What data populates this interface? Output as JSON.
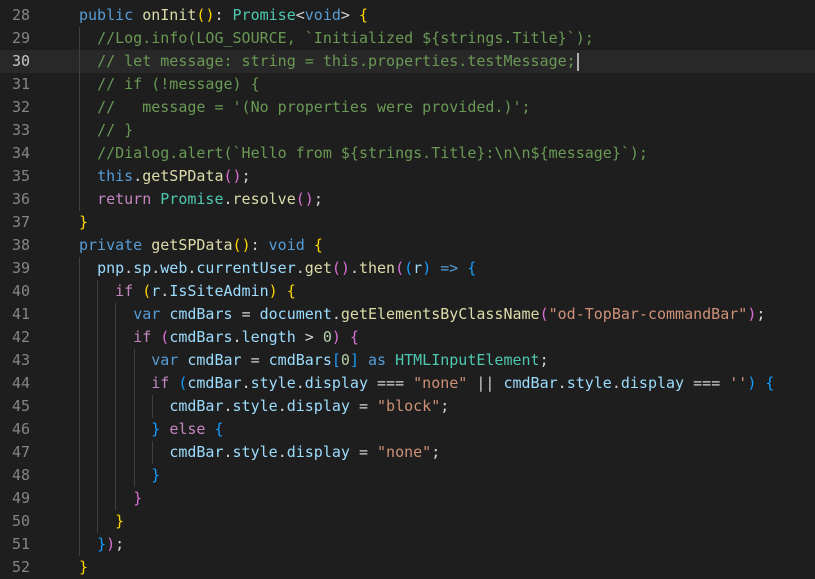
{
  "editor": {
    "language": "typescript",
    "active_line": 30,
    "colors": {
      "background": "#1e1e1e",
      "keyword": "#569cd6",
      "control": "#c586c0",
      "function": "#dcdcaa",
      "variable": "#9cdcfe",
      "type": "#4ec9b0",
      "string": "#ce9178",
      "comment": "#6a9955",
      "number": "#b5cea8",
      "bracket_1": "#ffd700",
      "bracket_2": "#da70d6",
      "bracket_3": "#179fff"
    },
    "lines": [
      {
        "number": "28",
        "text": "public onInit(): Promise<void> {"
      },
      {
        "number": "29",
        "text": "  //Log.info(LOG_SOURCE, `Initialized ${strings.Title}`);"
      },
      {
        "number": "30",
        "text": "  // let message: string = this.properties.testMessage;"
      },
      {
        "number": "31",
        "text": "  // if (!message) {"
      },
      {
        "number": "32",
        "text": "  //   message = '(No properties were provided.)';"
      },
      {
        "number": "33",
        "text": "  // }"
      },
      {
        "number": "34",
        "text": "  //Dialog.alert(`Hello from ${strings.Title}:\\n\\n${message}`);"
      },
      {
        "number": "35",
        "text": "  this.getSPData();"
      },
      {
        "number": "36",
        "text": "  return Promise.resolve();"
      },
      {
        "number": "37",
        "text": "}"
      },
      {
        "number": "38",
        "text": "private getSPData(): void {"
      },
      {
        "number": "39",
        "text": "  pnp.sp.web.currentUser.get().then((r) => {"
      },
      {
        "number": "40",
        "text": "    if (r.IsSiteAdmin) {"
      },
      {
        "number": "41",
        "text": "      var cmdBars = document.getElementsByClassName(\"od-TopBar-commandBar\");"
      },
      {
        "number": "42",
        "text": "      if (cmdBars.length > 0) {"
      },
      {
        "number": "43",
        "text": "        var cmdBar = cmdBars[0] as HTMLInputElement;"
      },
      {
        "number": "44",
        "text": "        if (cmdBar.style.display === \"none\" || cmdBar.style.display === '') {"
      },
      {
        "number": "45",
        "text": "          cmdBar.style.display = \"block\";"
      },
      {
        "number": "46",
        "text": "        } else {"
      },
      {
        "number": "47",
        "text": "          cmdBar.style.display = \"none\";"
      },
      {
        "number": "48",
        "text": "        }"
      },
      {
        "number": "49",
        "text": "      }"
      },
      {
        "number": "50",
        "text": "    }"
      },
      {
        "number": "51",
        "text": "  });"
      },
      {
        "number": "52",
        "text": "}"
      }
    ]
  }
}
